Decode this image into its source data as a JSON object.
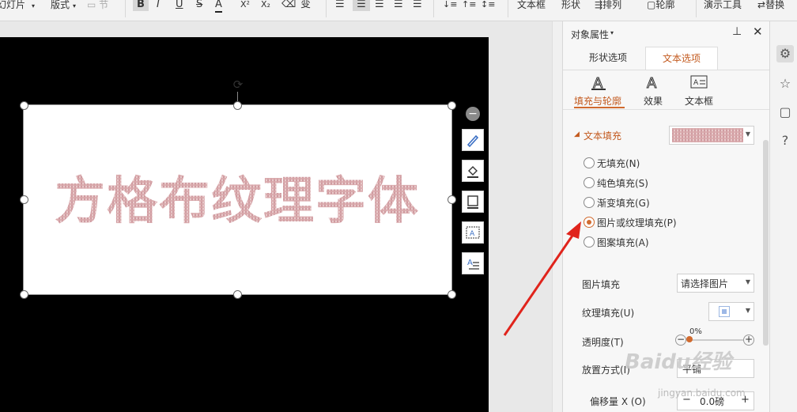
{
  "toolbar": {
    "slides_label": "幻灯片",
    "layout_label": "版式",
    "section_label": "节",
    "bold": "B",
    "italic": "I",
    "underline": "U",
    "strike": "S",
    "font_color": "A",
    "superscript": "X²",
    "subscript": "X₂",
    "clear": "⌫",
    "phonetic": "变",
    "textbox_label": "文本框",
    "shape_label": "形状",
    "arrange_label": "排列",
    "outline_label": "轮廓",
    "present_label": "演示工具",
    "replace_label": "替换"
  },
  "slide": {
    "text": "方格布纹理字体",
    "text_fill_color": "#d9a9ab"
  },
  "panel": {
    "title": "对象属性",
    "tabs": [
      "形状选项",
      "文本选项"
    ],
    "active_tab": 1,
    "subtabs": [
      "填充与轮廓",
      "效果",
      "文本框"
    ],
    "active_subtab": 0,
    "section_title": "文本填充",
    "fill_options": [
      "无填充(N)",
      "纯色填充(S)",
      "渐变填充(G)",
      "图片或纹理填充(P)",
      "图案填充(A)"
    ],
    "selected_fill": 3,
    "picture_fill_label": "图片填充",
    "picture_fill_value": "请选择图片",
    "texture_fill_label": "纹理填充(U)",
    "transparency_label": "透明度(T)",
    "transparency_value": "0%",
    "placement_label": "放置方式(I)",
    "placement_value": "平铺",
    "offset_x_label": "偏移量 X (O)",
    "offset_x_value": "0.0磅",
    "accent_color": "#d16a2e"
  },
  "watermark": {
    "text": "Baidu经验",
    "url": "jingyan.baidu.com"
  }
}
